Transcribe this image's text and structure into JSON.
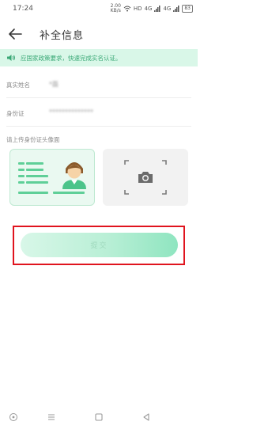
{
  "status_bar": {
    "time": "17:24",
    "net_speed": "2.00",
    "net_unit": "KB/s",
    "hd": "HD",
    "signal_1": "4G",
    "signal_2": "4G",
    "battery": "83"
  },
  "header": {
    "title": "补全信息"
  },
  "notice": {
    "text": "应国家政策要求，快速完成实名认证。"
  },
  "form": {
    "name_label": "真实姓名",
    "name_value": "*磊",
    "id_label": "身份证",
    "id_value": "**************",
    "upload_label": "请上传身份证头像面"
  },
  "submit": {
    "label": "提交"
  },
  "icons": {
    "back": "back-arrow-icon",
    "speaker": "speaker-icon",
    "camera": "camera-icon",
    "id_card": "id-card-illustration",
    "nav_back": "nav-back-icon",
    "nav_home": "nav-home-icon",
    "nav_menu": "nav-menu-icon",
    "nav_assistant": "nav-assistant-icon"
  },
  "colors": {
    "accent": "#3aa876",
    "notice_bg": "#d9f7e8",
    "highlight": "#e0141e"
  }
}
